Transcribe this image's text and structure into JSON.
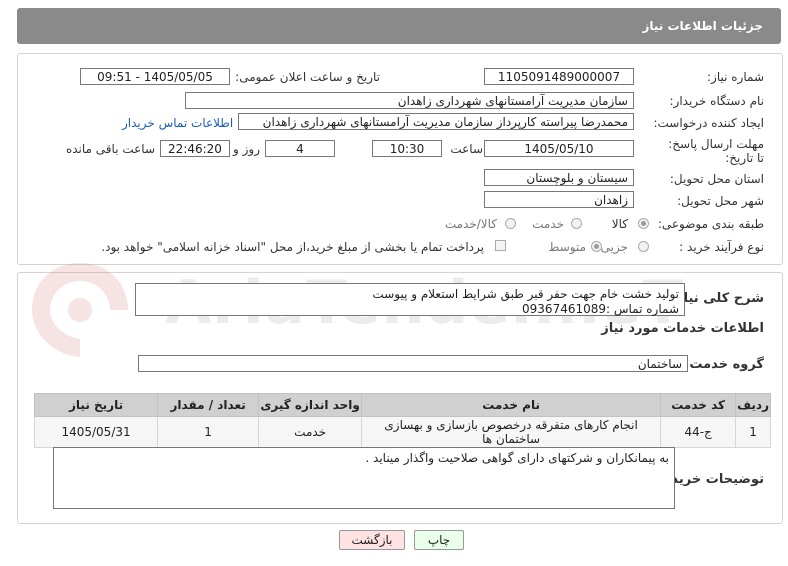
{
  "header": {
    "title": "جزئیات اطلاعات نیاز"
  },
  "form": {
    "need_number_label": "شماره نیاز:",
    "need_number": "1105091489000007",
    "announce_label": "تاریخ و ساعت اعلان عمومی:",
    "announce_value": "1405/05/05 - 09:51",
    "buyer_org_label": "نام دستگاه خریدار:",
    "buyer_org": "سازمان مدیریت آرامستانهای شهرداری زاهدان",
    "requester_label": "ایجاد کننده درخواست:",
    "requester": "محمدرضا پیراسته کارپرداز سازمان مدیریت آرامستانهای شهرداری زاهدان",
    "contact_link": "اطلاعات تماس خریدار",
    "deadline_label": "مهلت ارسال پاسخ: تا تاریخ:",
    "deadline_date": "1405/05/10",
    "time_label": "ساعت",
    "deadline_time": "10:30",
    "days_value": "4",
    "days_label": "روز و",
    "remaining_time": "22:46:20",
    "remaining_label": "ساعت باقی مانده",
    "province_label": "استان محل تحویل:",
    "province": "سیستان و بلوچستان",
    "city_label": "شهر محل تحویل:",
    "city": "زاهدان",
    "category_label": "طبقه بندی موضوعی:",
    "category_options": [
      "کالا",
      "خدمت",
      "کالا/خدمت"
    ],
    "process_label": "نوع فرآیند خرید :",
    "process_options": [
      "جزیی",
      "متوسط"
    ],
    "payment_note": "پرداخت تمام یا بخشی از مبلغ خرید،از محل \"اسناد خزانه اسلامی\" خواهد بود."
  },
  "summary": {
    "label": "شرح کلی نیاز:",
    "line1": "تولید خشت خام جهت حفر قبر  طبق شرایط استعلام و پیوست",
    "line2": "شماره تماس :09367461089"
  },
  "services": {
    "section_title": "اطلاعات خدمات مورد نیاز",
    "group_label": "گروه خدمت:",
    "group_value": "ساختمان",
    "columns": [
      "ردیف",
      "کد خدمت",
      "نام خدمت",
      "واحد اندازه گیری",
      "تعداد / مقدار",
      "تاریخ نیاز"
    ],
    "rows": [
      {
        "row": "1",
        "code": "ج-44",
        "name": "انجام کارهای متفرقه درخصوص بازسازی و بهسازی ساختمان ها",
        "unit": "خدمت",
        "qty": "1",
        "date": "1405/05/31"
      }
    ]
  },
  "buyer_notes": {
    "label": "توضیحات خریدار:",
    "text": "به پیمانکاران و شرکتهای دارای گواهی صلاحیت واگذار میناید ."
  },
  "buttons": {
    "print": "چاپ",
    "back": "بازگشت"
  },
  "watermark": {
    "text": "AriaTender.neT"
  }
}
